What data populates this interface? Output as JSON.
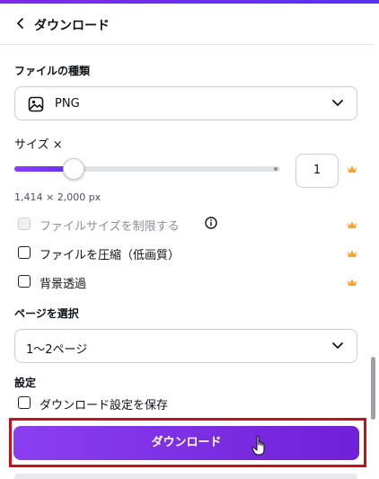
{
  "header": {
    "title": "ダウンロード"
  },
  "file_type": {
    "label": "ファイルの種類",
    "selected": "PNG"
  },
  "size": {
    "label": "サイズ ×",
    "value": "1",
    "slider_fraction": 0.22,
    "dimensions": "1,414 × 2,000 px"
  },
  "options": [
    {
      "label": "ファイルサイズを制限する",
      "checked": false,
      "disabled": true,
      "premium": true
    },
    {
      "label": "ファイルを圧縮（低画質）",
      "checked": false,
      "disabled": false,
      "premium": true
    },
    {
      "label": "背景透過",
      "checked": false,
      "disabled": false,
      "premium": true
    }
  ],
  "pages": {
    "label": "ページを選択",
    "selected": "1〜2ページ"
  },
  "settings": {
    "label": "設定",
    "save_label": "ダウンロード設定を保存"
  },
  "download_button": "ダウンロード",
  "colors": {
    "accent": "#7d2ae8",
    "crown": "#f5a623",
    "highlight": "#c8101b"
  }
}
